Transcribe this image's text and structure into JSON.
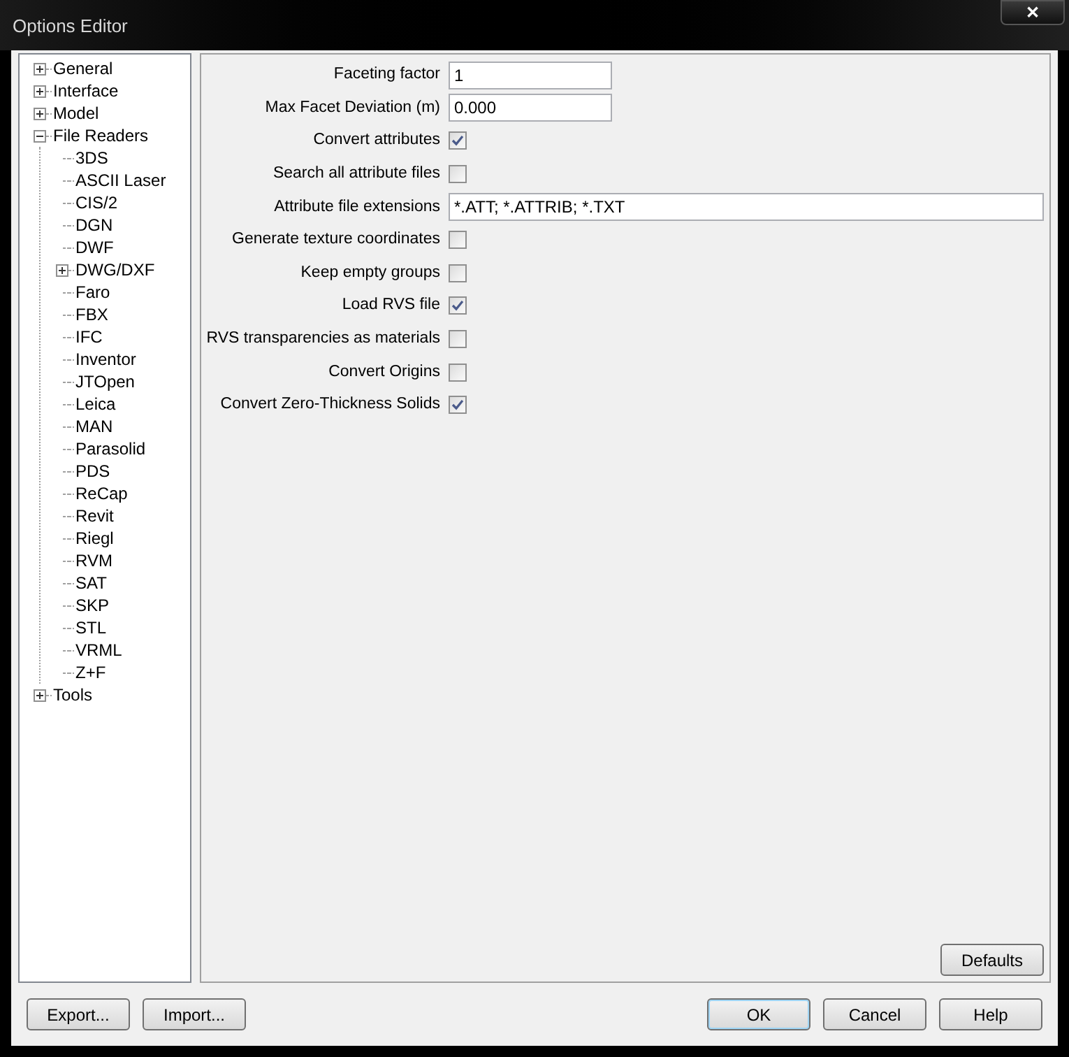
{
  "window": {
    "title": "Options Editor",
    "close": "✕"
  },
  "tree": [
    {
      "label": "General",
      "expanded": false
    },
    {
      "label": "Interface",
      "expanded": false
    },
    {
      "label": "Model",
      "expanded": false
    },
    {
      "label": "File Readers",
      "expanded": true,
      "children": [
        {
          "label": "3DS"
        },
        {
          "label": "ASCII Laser"
        },
        {
          "label": "CIS/2"
        },
        {
          "label": "DGN"
        },
        {
          "label": "DWF"
        },
        {
          "label": "DWG/DXF",
          "expanded": false
        },
        {
          "label": "Faro"
        },
        {
          "label": "FBX"
        },
        {
          "label": "IFC"
        },
        {
          "label": "Inventor"
        },
        {
          "label": "JTOpen"
        },
        {
          "label": "Leica"
        },
        {
          "label": "MAN"
        },
        {
          "label": "Parasolid"
        },
        {
          "label": "PDS"
        },
        {
          "label": "ReCap"
        },
        {
          "label": "Revit"
        },
        {
          "label": "Riegl"
        },
        {
          "label": "RVM"
        },
        {
          "label": "SAT"
        },
        {
          "label": "SKP"
        },
        {
          "label": "STL"
        },
        {
          "label": "VRML"
        },
        {
          "label": "Z+F"
        }
      ]
    },
    {
      "label": "Tools",
      "expanded": false
    }
  ],
  "settings": [
    {
      "kind": "text",
      "label": "Faceting factor",
      "value": "1",
      "wide": false
    },
    {
      "kind": "text",
      "label": "Max Facet Deviation (m)",
      "value": "0.000",
      "wide": false
    },
    {
      "kind": "checkbox",
      "label": "Convert attributes",
      "checked": true
    },
    {
      "kind": "checkbox",
      "label": "Search all attribute files",
      "checked": false
    },
    {
      "kind": "text",
      "label": "Attribute file extensions",
      "value": "*.ATT; *.ATTRIB; *.TXT",
      "wide": true
    },
    {
      "kind": "checkbox",
      "label": "Generate texture coordinates",
      "checked": false
    },
    {
      "kind": "checkbox",
      "label": "Keep empty groups",
      "checked": false
    },
    {
      "kind": "checkbox",
      "label": "Load RVS file",
      "checked": true
    },
    {
      "kind": "checkbox",
      "label": "RVS transparencies as materials",
      "checked": false
    },
    {
      "kind": "checkbox",
      "label": "Convert Origins",
      "checked": false
    },
    {
      "kind": "checkbox",
      "label": "Convert Zero-Thickness Solids",
      "checked": true
    }
  ],
  "defaults_button": "Defaults",
  "left_buttons": [
    "Export...",
    "Import..."
  ],
  "right_buttons": [
    {
      "label": "OK",
      "default": true
    },
    {
      "label": "Cancel",
      "default": false
    },
    {
      "label": "Help",
      "default": false
    }
  ]
}
